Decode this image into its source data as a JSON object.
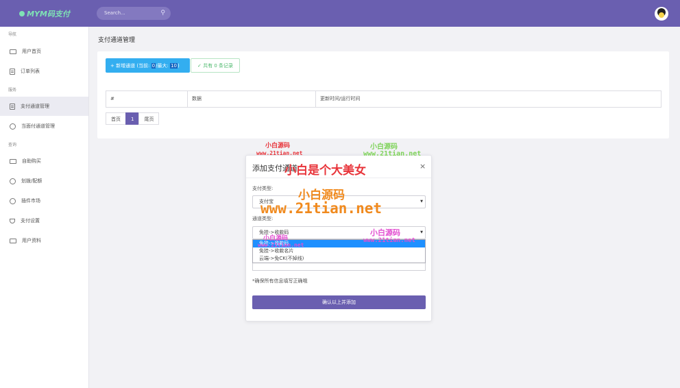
{
  "header": {
    "brand": "MYM码支付",
    "search_placeholder": "Search..."
  },
  "sidebar": {
    "group_nav": "导航",
    "group_service": "服务",
    "group_query": "查询",
    "items": [
      {
        "label": "用户首页",
        "icon": "monitor-icon"
      },
      {
        "label": "订单列表",
        "icon": "document-icon"
      },
      {
        "label": "支付通道管理",
        "icon": "document-icon"
      },
      {
        "label": "当面付通道管理",
        "icon": "circle-icon"
      },
      {
        "label": "自助购买",
        "icon": "monitor-icon"
      },
      {
        "label": "划拨/配额",
        "icon": "refresh-icon"
      },
      {
        "label": "插件市场",
        "icon": "plugin-icon"
      },
      {
        "label": "支付设置",
        "icon": "trophy-icon"
      },
      {
        "label": "用户资料",
        "icon": "wallet-icon"
      }
    ]
  },
  "main": {
    "page_title": "支付通道管理",
    "add_button_prefix": "+ 新增通道 (当前:",
    "add_button_current": "0",
    "add_button_middle": "/最大:",
    "add_button_max": "10",
    "add_button_suffix": ")",
    "count_label": "✓ 共有 0 条记录",
    "table_headers": [
      "#",
      "数据",
      "更新时间/运行时间"
    ],
    "pager": [
      "首页",
      "1",
      "尾页"
    ]
  },
  "modal": {
    "title": "添加支付通道",
    "close": "×",
    "pay_type_label": "支付类型:",
    "pay_type_value": "支付宝",
    "channel_type_label": "通道类型:",
    "channel_type_value": "免挂->收款码",
    "options": [
      "免挂->收款码",
      "免挂->收款名片",
      "云端->免CK(不掉线)"
    ],
    "note": "*确保所有信息填写正确哦",
    "submit": "确认以上并添加"
  },
  "watermarks": {
    "line1": "小白源码",
    "line2": "www.21tian.net",
    "big_title": "小白是个大美女",
    "big_url": "www.21tian.net",
    "colors": {
      "red": "#e8343a",
      "orange": "#f08a1e",
      "green": "#7fd35a",
      "pink": "#e24fd1"
    }
  }
}
